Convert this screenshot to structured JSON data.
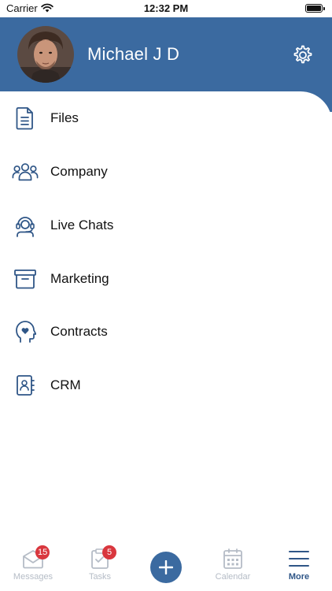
{
  "status_bar": {
    "carrier": "Carrier",
    "time": "12:32 PM"
  },
  "header": {
    "user_name": "Michael J D",
    "background_color": "#3b6aa0"
  },
  "menu": {
    "items": [
      {
        "label": "Files",
        "icon": "file-icon"
      },
      {
        "label": "Company",
        "icon": "group-icon"
      },
      {
        "label": "Live Chats",
        "icon": "headset-icon"
      },
      {
        "label": "Marketing",
        "icon": "archive-icon"
      },
      {
        "label": "Contracts",
        "icon": "heart-head-icon"
      },
      {
        "label": "CRM",
        "icon": "contact-book-icon"
      }
    ]
  },
  "tab_bar": {
    "tabs": [
      {
        "label": "Messages",
        "icon": "envelope-icon",
        "badge": "15",
        "active": false
      },
      {
        "label": "Tasks",
        "icon": "clipboard-icon",
        "badge": "5",
        "active": false
      },
      {
        "label": "",
        "icon": "plus-icon",
        "active": false
      },
      {
        "label": "Calendar",
        "icon": "calendar-icon",
        "active": false
      },
      {
        "label": "More",
        "icon": "hamburger-icon",
        "active": true
      }
    ],
    "accent_color": "#2f5687",
    "inactive_color": "#b5bcc6",
    "badge_color": "#d9373e"
  }
}
